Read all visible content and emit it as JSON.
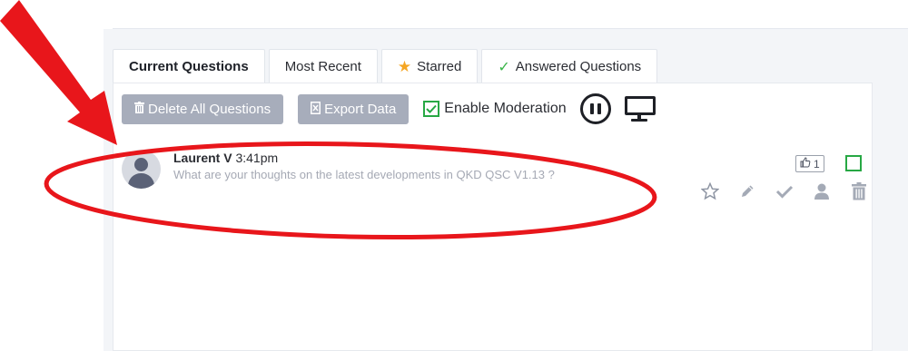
{
  "tabs": [
    {
      "label": "Current Questions",
      "active": true
    },
    {
      "label": "Most Recent",
      "active": false
    },
    {
      "label": "Starred",
      "active": false,
      "icon": "star-icon"
    },
    {
      "label": "Answered Questions",
      "active": false,
      "icon": "check-icon"
    }
  ],
  "toolbar": {
    "delete_all_label": "Delete All Questions",
    "export_label": "Export Data",
    "moderation_label": "Enable Moderation",
    "moderation_checked": true
  },
  "question": {
    "author": "Laurent V",
    "time": "3:41pm",
    "text": "What are your thoughts on the latest developments in QKD QSC V1.13 ?",
    "likes": "1"
  },
  "colors": {
    "annotation_red": "#e8161b",
    "accent_green": "#27a844",
    "star_gold": "#f5a623",
    "button_grey": "#a7adbb",
    "icon_grey": "#a4aab6"
  }
}
